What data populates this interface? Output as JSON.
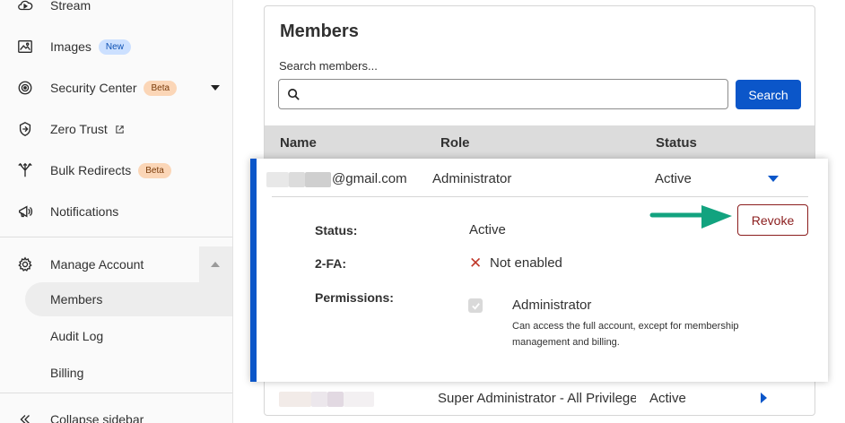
{
  "sidebar": {
    "items": [
      {
        "label": "Stream",
        "icon": "stream-cloud-icon"
      },
      {
        "label": "Images",
        "icon": "images-icon",
        "badge": "New"
      },
      {
        "label": "Security Center",
        "icon": "security-center-icon",
        "badge": "Beta"
      },
      {
        "label": "Zero Trust",
        "icon": "zero-trust-icon"
      },
      {
        "label": "Bulk Redirects",
        "icon": "bulk-redirects-icon",
        "badge": "Beta"
      },
      {
        "label": "Notifications",
        "icon": "notifications-icon"
      },
      {
        "label": "Manage Account",
        "icon": "gear-icon"
      }
    ],
    "manage_account_children": [
      {
        "label": "Members",
        "active": true
      },
      {
        "label": "Audit Log"
      },
      {
        "label": "Billing"
      }
    ],
    "collapse_label": "Collapse sidebar"
  },
  "main": {
    "title": "Members",
    "search": {
      "label": "Search members...",
      "value": "",
      "button_label": "Search"
    },
    "table": {
      "columns": [
        "Name",
        "Role",
        "Status"
      ],
      "rows": [
        {
          "email_suffix": "@gmail.com",
          "role": "Administrator",
          "status": "Active",
          "expanded": true,
          "details": {
            "status_label": "Status:",
            "status_value": "Active",
            "twofa_label": "2-FA:",
            "twofa_value": "Not enabled",
            "permissions_label": "Permissions:",
            "permission_title": "Administrator",
            "permission_desc": "Can access the full account, except for membership management and billing.",
            "revoke_label": "Revoke"
          }
        },
        {
          "role": "Super Administrator - All Privileges",
          "status": "Active",
          "expanded": false
        }
      ]
    }
  },
  "colors": {
    "accent_blue": "#0b56c9",
    "revoke_red": "#8b1d1d",
    "annotation_arrow": "#12a37f",
    "badge_new_bg": "#cce0ff",
    "badge_beta_bg": "#fbd6b7"
  }
}
